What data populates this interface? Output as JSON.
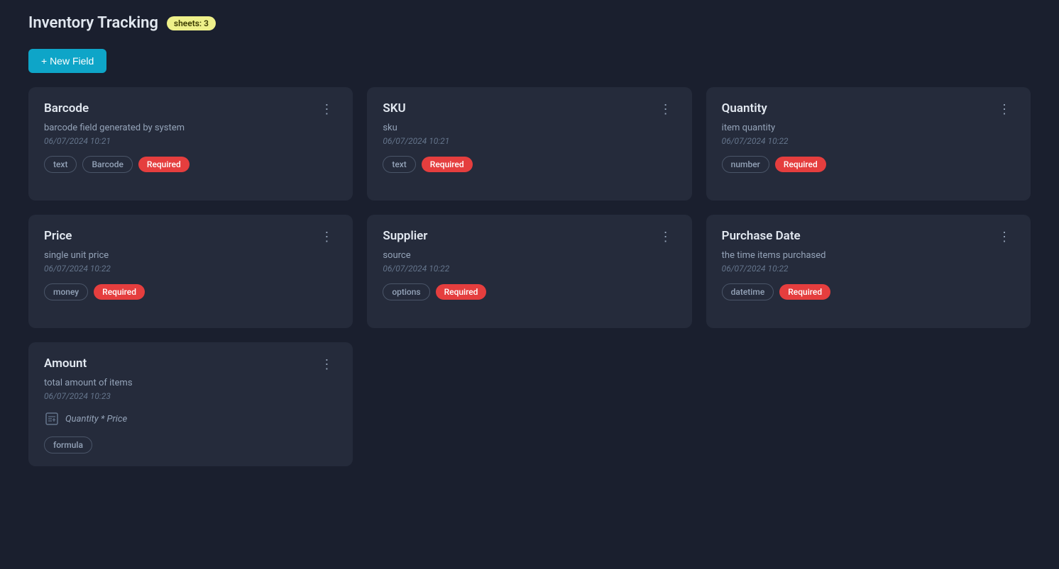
{
  "header": {
    "title": "Inventory Tracking",
    "sheets_badge": "sheets: 3",
    "new_field_label": "+ New Field"
  },
  "cards": [
    {
      "id": "barcode",
      "title": "Barcode",
      "description": "barcode field generated by system",
      "date": "06/07/2024 10:21",
      "tags": [
        "text",
        "Barcode",
        "Required"
      ],
      "tag_types": [
        "outline",
        "outline",
        "required"
      ],
      "has_formula": false
    },
    {
      "id": "sku",
      "title": "SKU",
      "description": "sku",
      "date": "06/07/2024 10:21",
      "tags": [
        "text",
        "Required"
      ],
      "tag_types": [
        "outline",
        "required"
      ],
      "has_formula": false
    },
    {
      "id": "quantity",
      "title": "Quantity",
      "description": "item quantity",
      "date": "06/07/2024 10:22",
      "tags": [
        "number",
        "Required"
      ],
      "tag_types": [
        "outline",
        "required"
      ],
      "has_formula": false
    },
    {
      "id": "price",
      "title": "Price",
      "description": "single unit price",
      "date": "06/07/2024 10:22",
      "tags": [
        "money",
        "Required"
      ],
      "tag_types": [
        "outline",
        "required"
      ],
      "has_formula": false
    },
    {
      "id": "supplier",
      "title": "Supplier",
      "description": "source",
      "date": "06/07/2024 10:22",
      "tags": [
        "options",
        "Required"
      ],
      "tag_types": [
        "outline",
        "required"
      ],
      "has_formula": false
    },
    {
      "id": "purchase-date",
      "title": "Purchase Date",
      "description": "the time items purchased",
      "date": "06/07/2024 10:22",
      "tags": [
        "datetime",
        "Required"
      ],
      "tag_types": [
        "outline",
        "required"
      ],
      "has_formula": false
    },
    {
      "id": "amount",
      "title": "Amount",
      "description": "total amount of items",
      "date": "06/07/2024 10:23",
      "tags": [
        "formula"
      ],
      "tag_types": [
        "outline"
      ],
      "has_formula": true,
      "formula": "Quantity * Price"
    }
  ],
  "menu_icon": "⋮"
}
